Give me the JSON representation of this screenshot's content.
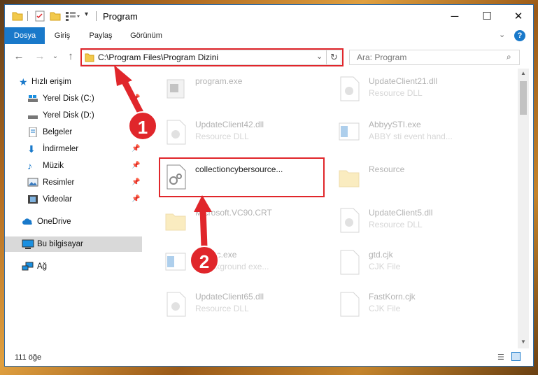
{
  "window": {
    "title": "Program"
  },
  "ribbon": {
    "tabs": [
      "Dosya",
      "Giriş",
      "Paylaş",
      "Görünüm"
    ]
  },
  "address": {
    "path": "C:\\Program Files\\Program Dizini"
  },
  "search": {
    "placeholder": "Ara: Program"
  },
  "sidebar": {
    "quick_access": "Hızlı erişim",
    "items": [
      "Yerel Disk (C:)",
      "Yerel Disk (D:)",
      "Belgeler",
      "İndirmeler",
      "Müzik",
      "Resimler",
      "Videolar"
    ],
    "onedrive": "OneDrive",
    "thispc": "Bu bilgisayar",
    "network": "Ağ"
  },
  "files": [
    {
      "name": "program.exe",
      "type": ""
    },
    {
      "name": "UpdateClient21.dll",
      "type": "Resource DLL"
    },
    {
      "name": "UpdateClient42.dll",
      "type": "Resource DLL"
    },
    {
      "name": "AbbyySTI.exe",
      "type": "ABBY sti event hand..."
    },
    {
      "name": "collectioncybersource...",
      "type": ""
    },
    {
      "name": "Resource",
      "type": ""
    },
    {
      "name": "Microsoft.VC90.CRT",
      "type": ""
    },
    {
      "name": "UpdateClient5.dll",
      "type": "Resource DLL"
    },
    {
      "name": "...Exec.exe",
      "type": "...background exe..."
    },
    {
      "name": "gtd.cjk",
      "type": "CJK File"
    },
    {
      "name": "UpdateClient65.dll",
      "type": "Resource DLL"
    },
    {
      "name": "FastKorn.cjk",
      "type": "CJK File"
    }
  ],
  "status": {
    "count": "111 öğe"
  },
  "annotations": {
    "step1": "1",
    "step2": "2"
  },
  "colors": {
    "accent": "#1979ca",
    "highlight": "#e0262b"
  }
}
